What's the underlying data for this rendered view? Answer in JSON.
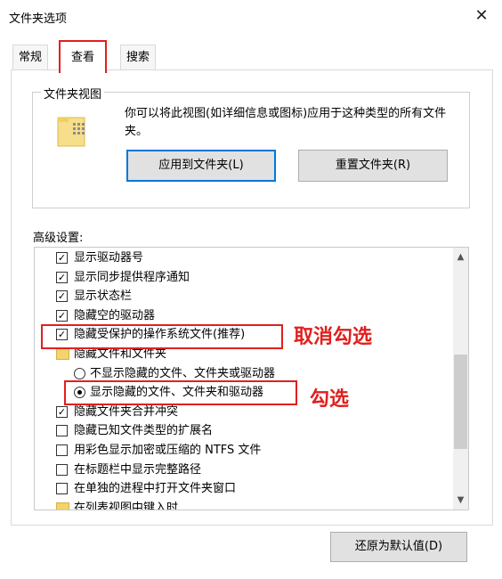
{
  "window": {
    "title": "文件夹选项",
    "close_glyph": "✕"
  },
  "tabs": [
    "常规",
    "查看",
    "搜索"
  ],
  "folder_view": {
    "legend": "文件夹视图",
    "description": "你可以将此视图(如详细信息或图标)应用于这种类型的所有文件夹。",
    "apply_button": "应用到文件夹(L)",
    "reset_button": "重置文件夹(R)"
  },
  "advanced": {
    "label": "高级设置:",
    "items": [
      {
        "type": "checkbox",
        "checked": true,
        "label": "显示驱动器号"
      },
      {
        "type": "checkbox",
        "checked": true,
        "label": "显示同步提供程序通知"
      },
      {
        "type": "checkbox",
        "checked": true,
        "label": "显示状态栏"
      },
      {
        "type": "checkbox",
        "checked": true,
        "label": "隐藏空的驱动器"
      },
      {
        "type": "checkbox",
        "checked": true,
        "label": "隐藏受保护的操作系统文件(推荐)"
      },
      {
        "type": "folder",
        "label": "隐藏文件和文件夹"
      },
      {
        "type": "radio",
        "checked": false,
        "label": "不显示隐藏的文件、文件夹或驱动器"
      },
      {
        "type": "radio",
        "checked": true,
        "label": "显示隐藏的文件、文件夹和驱动器"
      },
      {
        "type": "checkbox",
        "checked": true,
        "label": "隐藏文件夹合并冲突"
      },
      {
        "type": "checkbox",
        "checked": false,
        "label": "隐藏已知文件类型的扩展名"
      },
      {
        "type": "checkbox",
        "checked": false,
        "label": "用彩色显示加密或压缩的 NTFS 文件"
      },
      {
        "type": "checkbox",
        "checked": false,
        "label": "在标题栏中显示完整路径"
      },
      {
        "type": "checkbox",
        "checked": false,
        "label": "在单独的进程中打开文件夹窗口"
      },
      {
        "type": "folder",
        "label": "在列表视图中键入时"
      }
    ]
  },
  "restore_button": "还原为默认值(D)",
  "annotations": {
    "uncheck": "取消勾选",
    "check": "勾选"
  },
  "colors": {
    "annotation_red": "#e0201e",
    "focus_blue": "#0078d7"
  }
}
